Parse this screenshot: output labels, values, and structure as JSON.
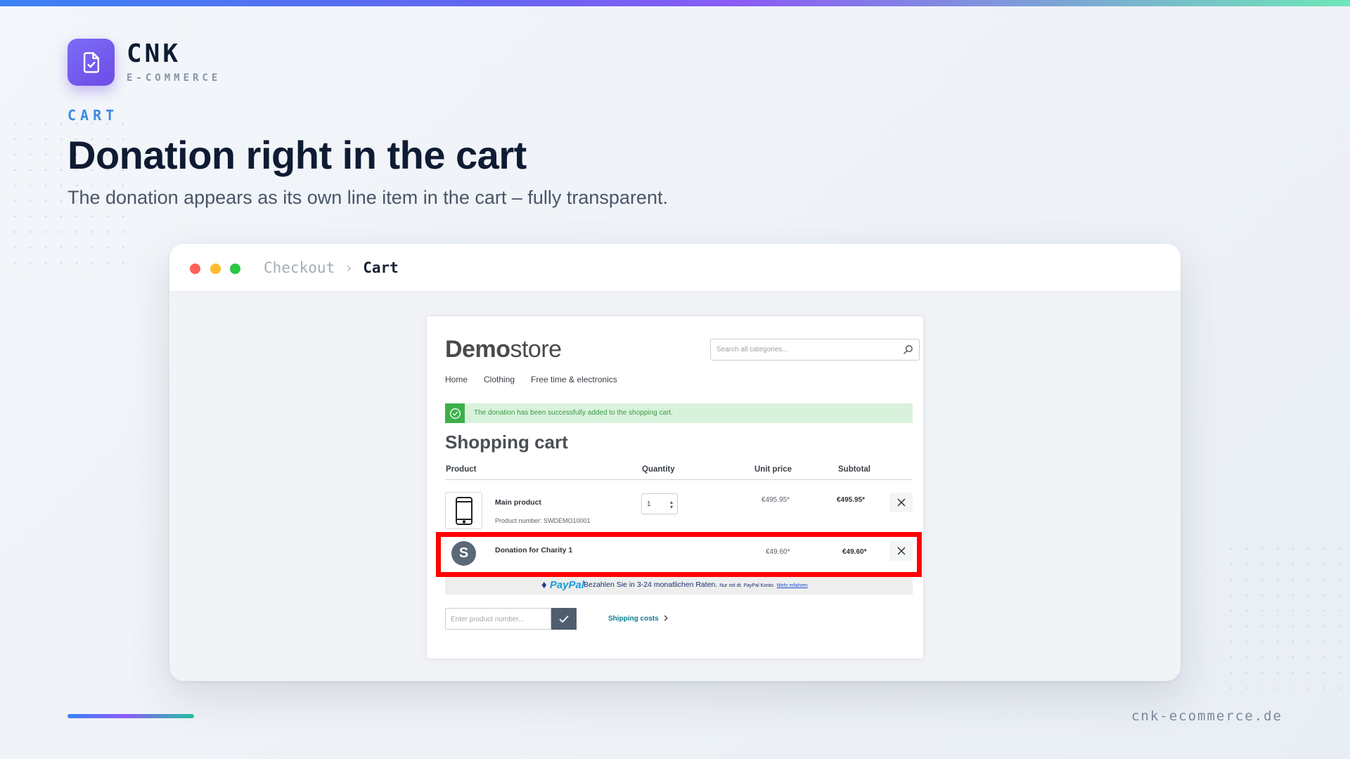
{
  "brand": {
    "name": "CNK",
    "tagline": "E-COMMERCE",
    "logo_icon": "document-check-icon",
    "accent_color": "#7c6cf6"
  },
  "slide": {
    "eyebrow": "CART",
    "headline": "Donation right in the cart",
    "subline": "The donation appears as its own line item in the cart – fully transparent."
  },
  "window": {
    "breadcrumb": [
      "Checkout",
      "Cart"
    ],
    "separator": "›"
  },
  "shop": {
    "logo_bold": "Demo",
    "logo_light": "store",
    "search": {
      "placeholder": "Search all categories...",
      "icon": "magnifier-icon"
    },
    "nav": [
      "Home",
      "Clothing",
      "Free time & electronics"
    ],
    "alert": {
      "text": "The donation has been successfully added to the shopping cart.",
      "icon": "check-circle-icon",
      "color": "#3cb04a"
    },
    "cart_title": "Shopping cart",
    "columns": {
      "product": "Product",
      "quantity": "Quantity",
      "unit_price": "Unit price",
      "subtotal": "Subtotal"
    },
    "items": [
      {
        "name": "Main product",
        "number": "Product number: SWDEMO10001",
        "quantity": "1",
        "unit_price": "€495.95*",
        "subtotal": "€495.95*",
        "thumb_icon": "smartphone-icon"
      },
      {
        "name": "Donation for Charity 1",
        "avatar_letter": "S",
        "unit_price": "€49.60*",
        "subtotal": "€49.60*",
        "highlight_color": "#ff0000"
      }
    ],
    "paypal": {
      "logo": "PayPal",
      "text": "Bezahlen Sie in 3-24 monatlichen Raten.",
      "small": "Nur mit dt. PayPal Konto.",
      "link": "Mehr erfahren"
    },
    "product_input": {
      "placeholder": "Enter product number..."
    },
    "shipping_link": "Shipping costs"
  },
  "footer": {
    "url": "cnk-ecommerce.de"
  }
}
